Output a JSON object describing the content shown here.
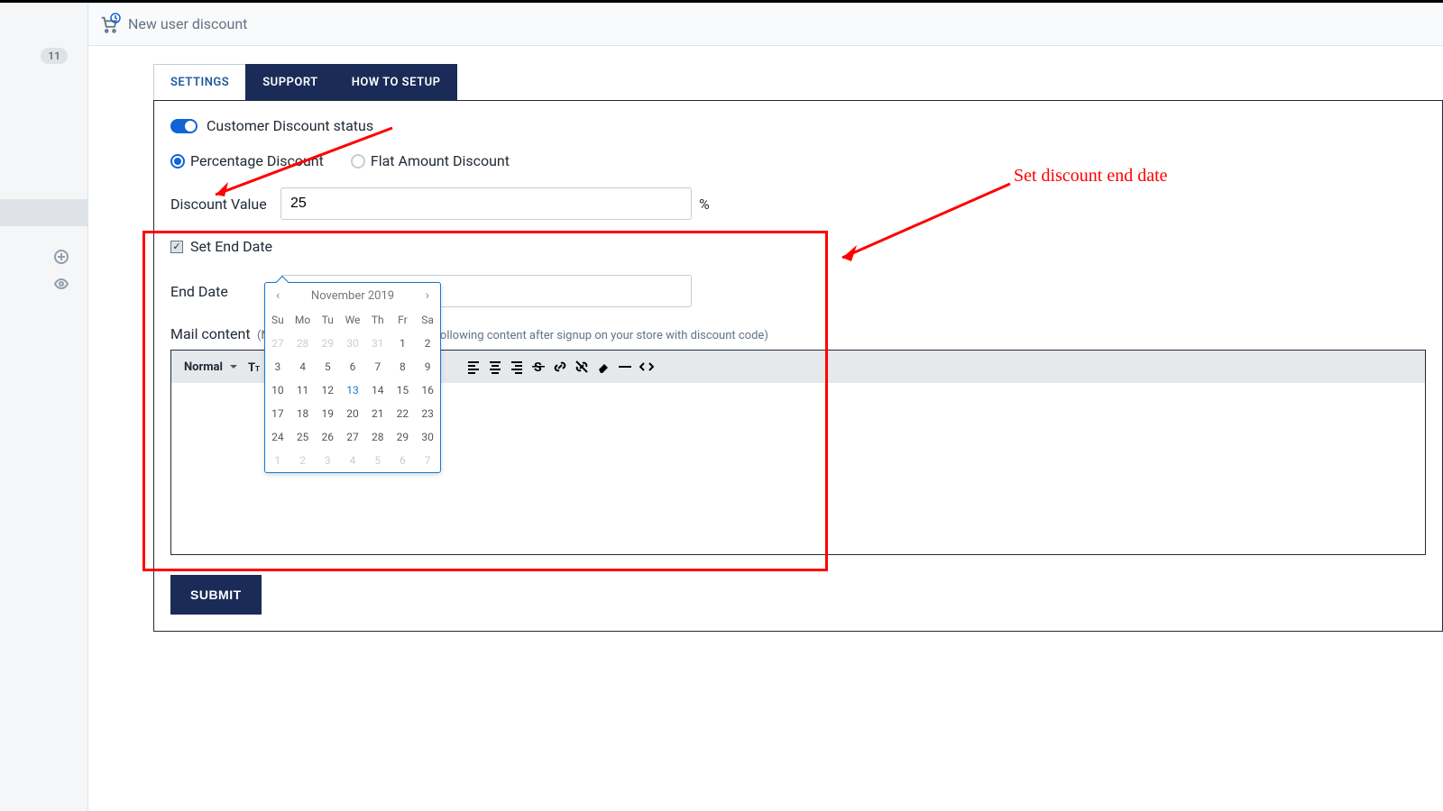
{
  "header": {
    "title": "New user discount"
  },
  "sidebar": {
    "badge": "11"
  },
  "tabs": {
    "items": [
      {
        "label": "SETTINGS",
        "active": true
      },
      {
        "label": "SUPPORT",
        "active": false
      },
      {
        "label": "HOW TO SETUP",
        "active": false
      }
    ]
  },
  "form": {
    "status_label": "Customer Discount status",
    "radio_pct": "Percentage Discount",
    "radio_flat": "Flat Amount Discount",
    "discount_value_label": "Discount Value",
    "discount_value": "25",
    "discount_unit": "%",
    "set_end_date_label": "Set End Date",
    "end_date_label": "End Date",
    "end_date_value": "2019-11-13",
    "mail_label": "Mail content",
    "mail_sub": "(New customer will get email with following content after signup on your store with discount code)",
    "submit": "SUBMIT"
  },
  "editor": {
    "font_size_label": "Normal"
  },
  "datepicker": {
    "title": "November 2019",
    "dow": [
      "Su",
      "Mo",
      "Tu",
      "We",
      "Th",
      "Fr",
      "Sa"
    ],
    "rows": [
      [
        {
          "d": "27",
          "o": true
        },
        {
          "d": "28",
          "o": true
        },
        {
          "d": "29",
          "o": true
        },
        {
          "d": "30",
          "o": true
        },
        {
          "d": "31",
          "o": true
        },
        {
          "d": "1"
        },
        {
          "d": "2"
        }
      ],
      [
        {
          "d": "3"
        },
        {
          "d": "4"
        },
        {
          "d": "5"
        },
        {
          "d": "6"
        },
        {
          "d": "7"
        },
        {
          "d": "8"
        },
        {
          "d": "9"
        }
      ],
      [
        {
          "d": "10"
        },
        {
          "d": "11"
        },
        {
          "d": "12"
        },
        {
          "d": "13",
          "sel": true
        },
        {
          "d": "14"
        },
        {
          "d": "15"
        },
        {
          "d": "16"
        }
      ],
      [
        {
          "d": "17"
        },
        {
          "d": "18"
        },
        {
          "d": "19"
        },
        {
          "d": "20"
        },
        {
          "d": "21"
        },
        {
          "d": "22"
        },
        {
          "d": "23"
        }
      ],
      [
        {
          "d": "24"
        },
        {
          "d": "25"
        },
        {
          "d": "26"
        },
        {
          "d": "27"
        },
        {
          "d": "28"
        },
        {
          "d": "29"
        },
        {
          "d": "30"
        }
      ],
      [
        {
          "d": "1",
          "o": true
        },
        {
          "d": "2",
          "o": true
        },
        {
          "d": "3",
          "o": true
        },
        {
          "d": "4",
          "o": true
        },
        {
          "d": "5",
          "o": true
        },
        {
          "d": "6",
          "o": true
        },
        {
          "d": "7",
          "o": true
        }
      ]
    ]
  },
  "annotation": {
    "end_date_note": "Set discount end date"
  }
}
